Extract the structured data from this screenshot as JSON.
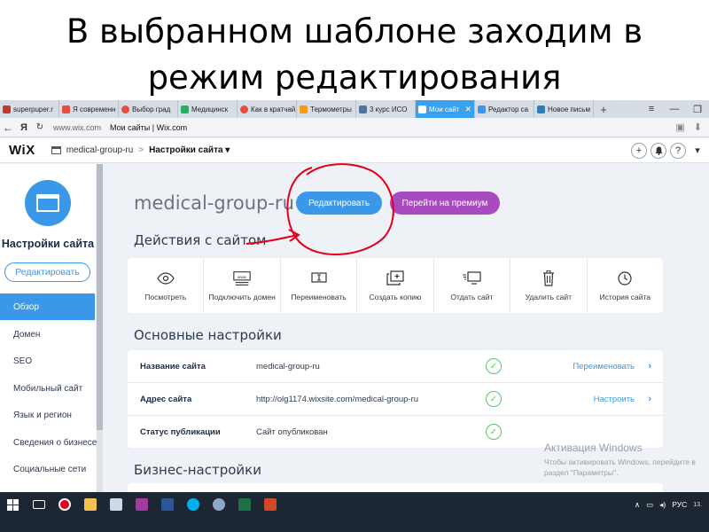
{
  "slide": {
    "title_line1": "В выбранном шаблоне заходим в",
    "title_line2": "режим редактирования"
  },
  "browser": {
    "tabs": [
      {
        "label": "superpuper.r",
        "color": "#c0392b"
      },
      {
        "label": "Я современн",
        "color": "#e74c3c"
      },
      {
        "label": "Выбор град",
        "color": "#e74c3c"
      },
      {
        "label": "Медицинск",
        "color": "#27ae60"
      },
      {
        "label": "Как в кратчай",
        "color": "#e74c3c"
      },
      {
        "label": "Термометры",
        "color": "#f39c12"
      },
      {
        "label": "3 курс ИСО",
        "color": "#4a76a8"
      },
      {
        "label": "Мои сайт",
        "color": "#ffffff",
        "active": true
      },
      {
        "label": "Редактор са",
        "color": "#3b97e8"
      },
      {
        "label": "Новое письм",
        "color": "#2980b9"
      }
    ],
    "new_tab": "+",
    "address": {
      "back": "←",
      "yandex": "Я",
      "url": "www.wix.com",
      "page_title": "Мои сайты | Wix.com"
    }
  },
  "wix": {
    "logo": "WiX",
    "site_name": "medical-group-ru",
    "separator": ">",
    "crumb": "Настройки сайта ▾",
    "right_buttons": [
      "+",
      "♫",
      "?"
    ]
  },
  "sidebar": {
    "title": "Настройки сайта",
    "edit_button": "Редактировать",
    "items": [
      {
        "label": "Обзор",
        "active": true
      },
      {
        "label": "Домен"
      },
      {
        "label": "SEO"
      },
      {
        "label": "Мобильный сайт"
      },
      {
        "label": "Язык и регион"
      },
      {
        "label": "Сведения о бизнесе"
      },
      {
        "label": "Социальные сети"
      }
    ]
  },
  "main": {
    "site_title": "medical-group-ru",
    "edit_button": "Редактировать",
    "premium_button": "Перейти на премиум",
    "actions_title": "Действия с сайтом",
    "actions": [
      {
        "label": "Посмотреть",
        "icon": "eye-icon"
      },
      {
        "label": "Подключить домен",
        "icon": "domain-icon"
      },
      {
        "label": "Переименовать",
        "icon": "rename-icon"
      },
      {
        "label": "Создать копию",
        "icon": "copy-icon"
      },
      {
        "label": "Отдать сайт",
        "icon": "transfer-icon"
      },
      {
        "label": "Удалить сайт",
        "icon": "trash-icon"
      },
      {
        "label": "История сайта",
        "icon": "clock-icon"
      }
    ],
    "settings_title": "Основные настройки",
    "settings": [
      {
        "key": "Название сайта",
        "value": "medical-group-ru",
        "link": "Переименовать",
        "chevron": "›"
      },
      {
        "key": "Адрес сайта",
        "value": "http://olg1174.wixsite.com/medical-group-ru",
        "link": "Настроить",
        "chevron": "›"
      },
      {
        "key": "Статус публикации",
        "value": "Сайт опубликован",
        "link": "",
        "chevron": ""
      }
    ],
    "check_mark": "✓",
    "business_title": "Бизнес-настройки"
  },
  "watermark": {
    "line1": "Активация Windows",
    "line2": "Чтобы активировать Windows, перейдите в",
    "line3": "раздел \"Параметры\"."
  },
  "taskbar": {
    "lang": "РУС",
    "time": "13."
  },
  "colors": {
    "wix_blue": "#3b97e8",
    "premium_purple": "#a94bc0",
    "annotation_red": "#e0001b",
    "check_green": "#5cc46a"
  }
}
